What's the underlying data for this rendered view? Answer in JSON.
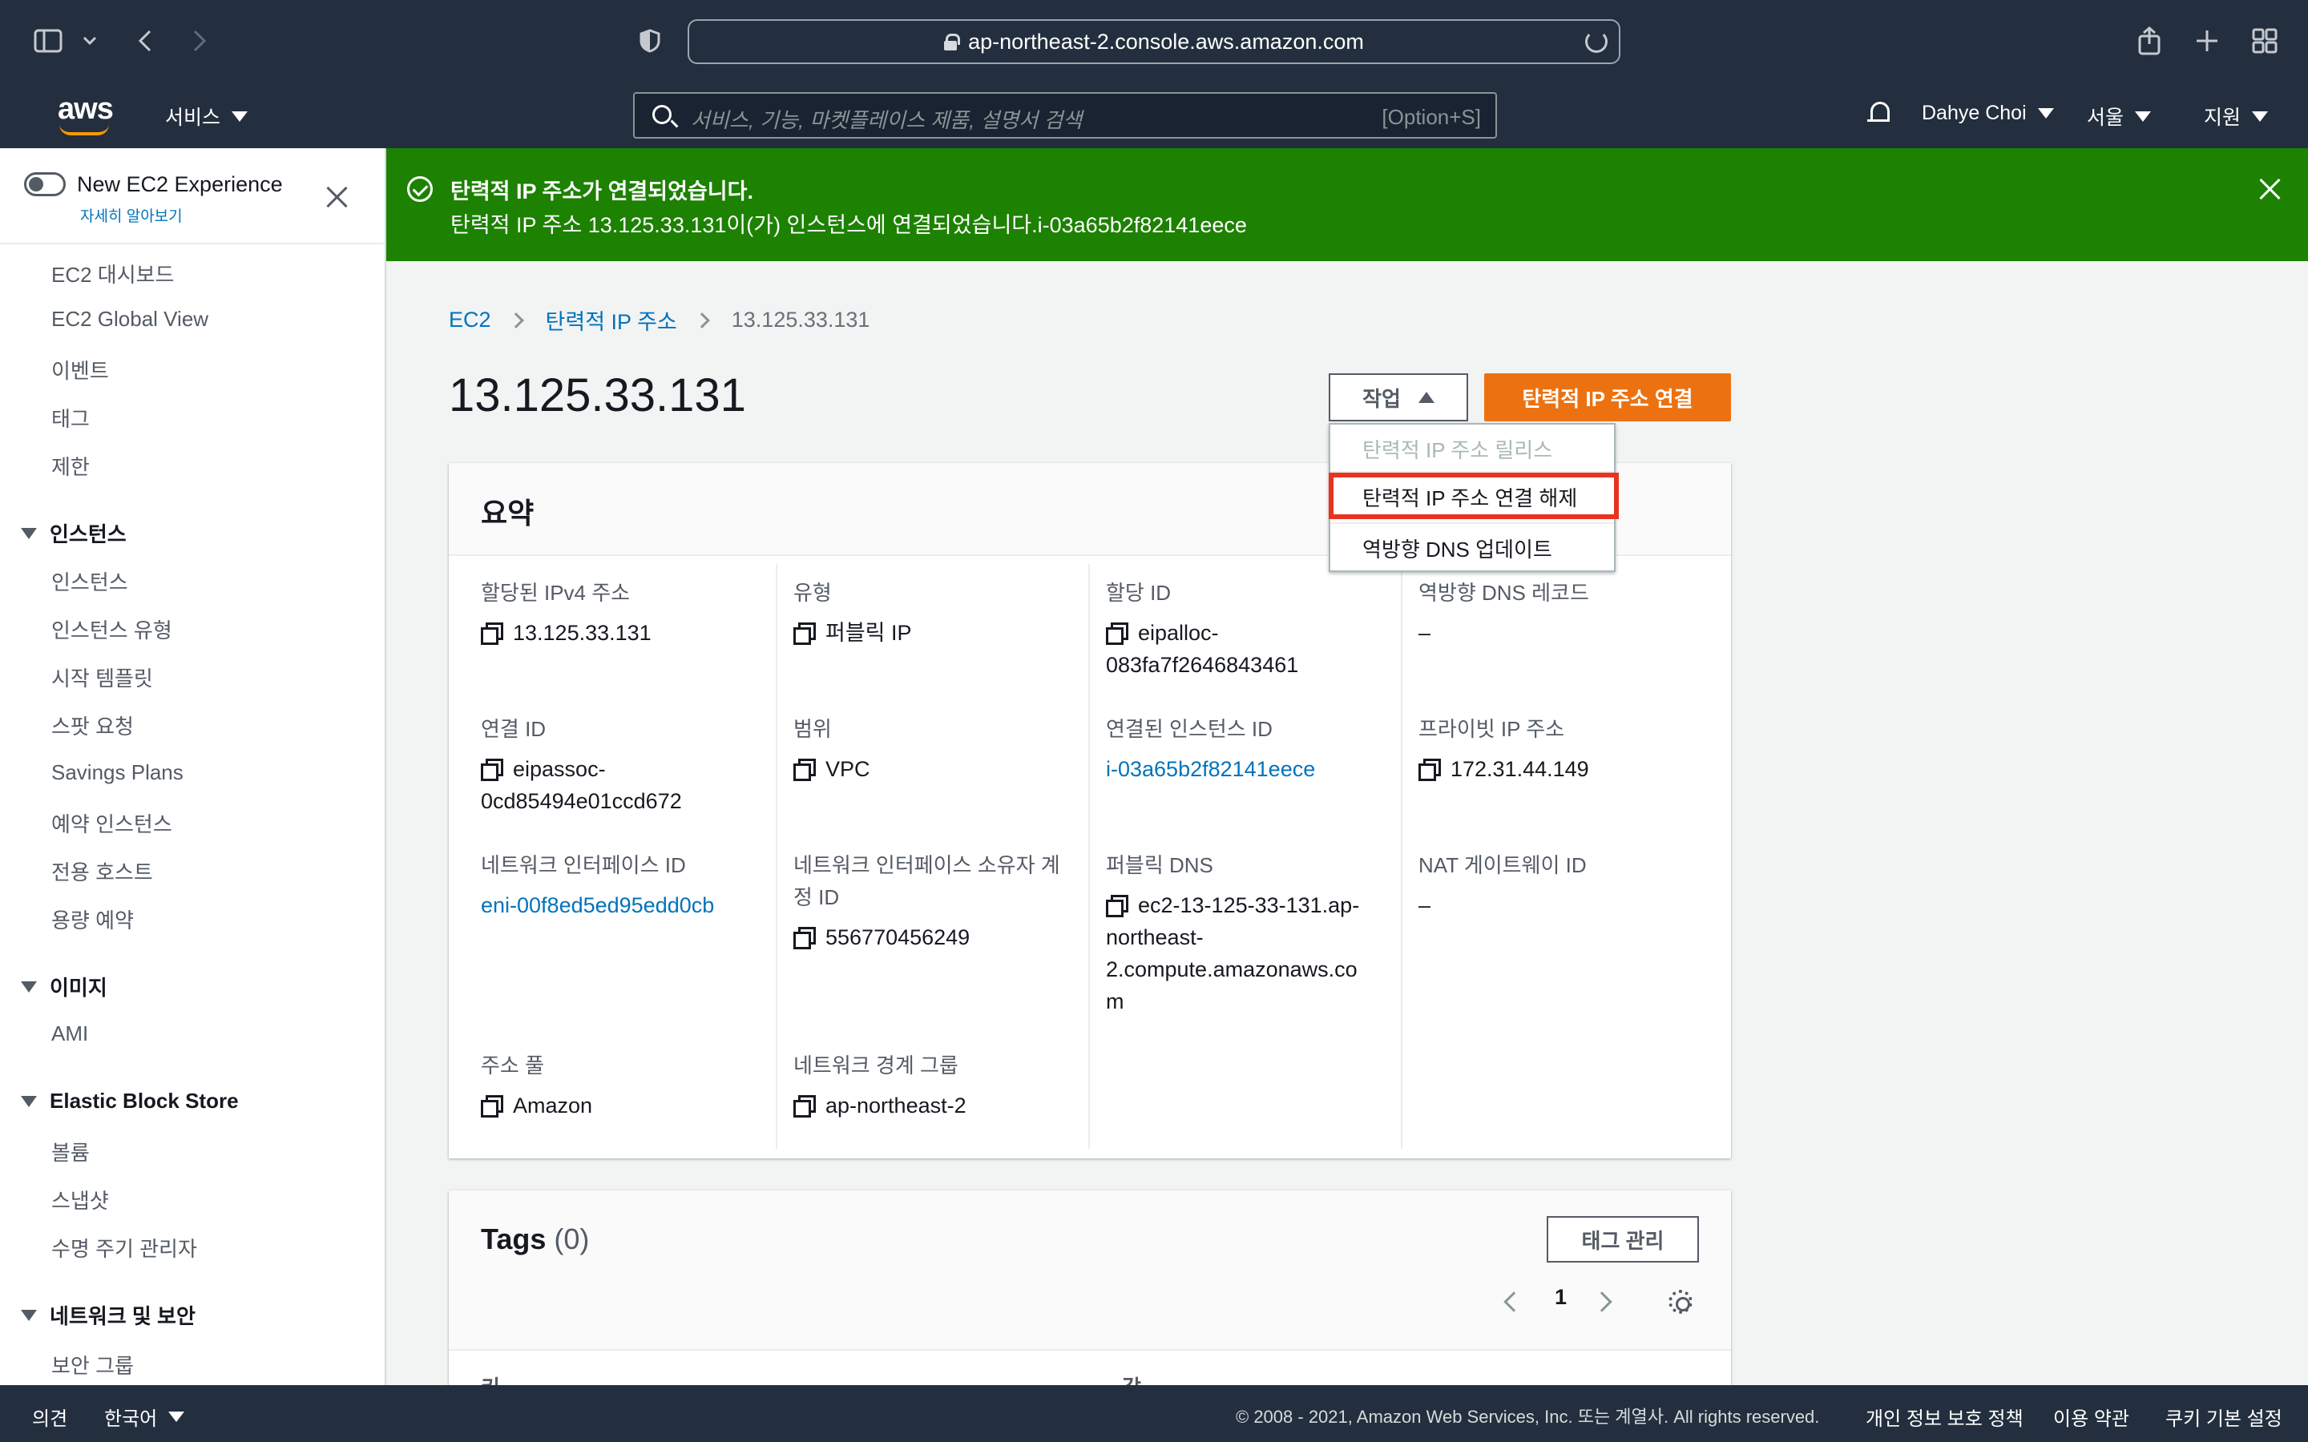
{
  "browser": {
    "url": "ap-northeast-2.console.aws.amazon.com"
  },
  "topnav": {
    "logo": "aws",
    "services": "서비스",
    "search_placeholder": "서비스, 기능, 마켓플레이스 제품, 설명서 검색",
    "search_shortcut": "[Option+S]",
    "user": "Dahye Choi",
    "region": "서울",
    "support": "지원"
  },
  "sidebar": {
    "experience_label": "New EC2 Experience",
    "experience_link": "자세히 알아보기",
    "top_items": [
      "EC2 대시보드",
      "EC2 Global View",
      "이벤트",
      "태그",
      "제한"
    ],
    "sections": [
      {
        "title": "인스턴스",
        "items": [
          "인스턴스",
          "인스턴스 유형",
          "시작 템플릿",
          "스팟 요청",
          "Savings Plans",
          "예약 인스턴스",
          "전용 호스트",
          "용량 예약"
        ]
      },
      {
        "title": "이미지",
        "items": [
          "AMI"
        ]
      },
      {
        "title": "Elastic Block Store",
        "items": [
          "볼륨",
          "스냅샷",
          "수명 주기 관리자"
        ]
      },
      {
        "title": "네트워크 및 보안",
        "items": [
          "보안 그룹"
        ]
      }
    ]
  },
  "flash": {
    "title": "탄력적 IP 주소가 연결되었습니다.",
    "message": "탄력적 IP 주소 13.125.33.131이(가) 인스턴스에 연결되었습니다.i-03a65b2f82141eece"
  },
  "breadcrumb": [
    "EC2",
    "탄력적 IP 주소",
    "13.125.33.131"
  ],
  "page": {
    "title": "13.125.33.131",
    "actions_label": "작업",
    "primary_label": "탄력적 IP 주소 연결"
  },
  "dropdown": {
    "items": [
      "탄력적 IP 주소 릴리스",
      "탄력적 IP 주소 연결 해제",
      "역방향 DNS 업데이트"
    ]
  },
  "summary": {
    "title": "요약",
    "fields": [
      {
        "label": "할당된 IPv4 주소",
        "value": "13.125.33.131"
      },
      {
        "label": "유형",
        "value": "퍼블릭 IP"
      },
      {
        "label": "할당 ID",
        "value": "eipalloc-",
        "value2": "083fa7f2646843461"
      },
      {
        "label": "역방향 DNS 레코드",
        "value": "–"
      },
      {
        "label": "연결 ID",
        "value": "eipassoc-",
        "value2": "0cd85494e01ccd672"
      },
      {
        "label": "범위",
        "value": "VPC"
      },
      {
        "label": "연결된 인스턴스 ID",
        "value": "i-03a65b2f82141eece"
      },
      {
        "label": "프라이빗 IP 주소",
        "value": "172.31.44.149"
      },
      {
        "label": "네트워크 인터페이스 ID",
        "value": "eni-00f8ed5ed95edd0cb"
      },
      {
        "label": "네트워크 인터페이스 소유자 계",
        "label2": "정 ID",
        "value": "556770456249"
      },
      {
        "label": "퍼블릭 DNS",
        "value": "ec2-13-125-33-131.ap-",
        "value2": "northeast-",
        "value3": "2.compute.amazonaws.co",
        "value4": "m"
      },
      {
        "label": "NAT 게이트웨이 ID",
        "value": "–"
      },
      {
        "label": "주소 풀",
        "value": "Amazon"
      },
      {
        "label": "네트워크 경계 그룹",
        "value": "ap-northeast-2"
      }
    ]
  },
  "tags": {
    "title": "Tags",
    "count": "(0)",
    "manage_label": "태그 관리",
    "page": "1",
    "col_key": "키",
    "col_value": "값"
  },
  "footer": {
    "feedback": "의견",
    "language": "한국어",
    "copyright": "© 2008 - 2021, Amazon Web Services, Inc. 또는 계열사. All rights reserved.",
    "privacy": "개인 정보 보호 정책",
    "terms": "이용 약관",
    "cookies": "쿠키 기본 설정"
  }
}
